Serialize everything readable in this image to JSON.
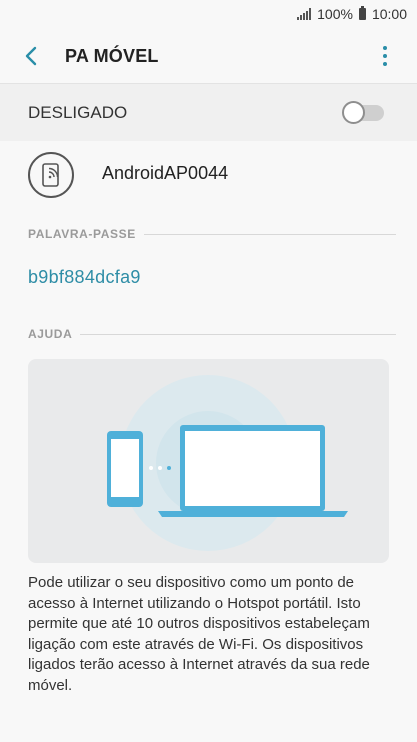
{
  "status_bar": {
    "battery_percent": "100%",
    "time": "10:00",
    "icons": [
      "signal-icon",
      "battery-icon"
    ]
  },
  "app_bar": {
    "title": "PA MÓVEL",
    "back_icon": "chevron-left-icon",
    "more_icon": "more-vertical-icon"
  },
  "hotspot_switch": {
    "label": "DESLIGADO",
    "state": "off"
  },
  "network": {
    "icon": "phone-hotspot-icon",
    "name": "AndroidAP0044"
  },
  "password_section": {
    "header": "PALAVRA-PASSE",
    "value": "b9bf884dcfa9"
  },
  "help_section": {
    "header": "AJUDA",
    "illustration": "phone-to-laptop-hotspot-illustration",
    "text": "Pode utilizar o seu dispositivo como um ponto de acesso à Internet utilizando o Hotspot portátil. Isto permite que até 10 outros dispositivos estabeleçam ligação com este através de Wi-Fi. Os dispositivos ligados terão acesso à Internet através da sua rede móvel."
  },
  "colors": {
    "accent": "#2e8da6",
    "background": "#f8f8f8",
    "illustration_bg": "#e9eaeb",
    "device_blue": "#4fb0d9"
  }
}
